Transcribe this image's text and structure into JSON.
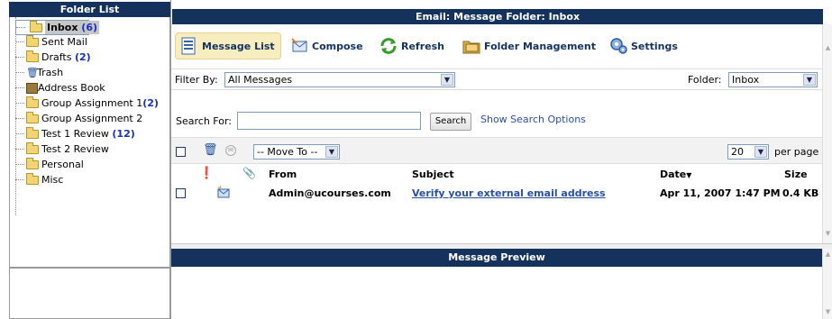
{
  "folder_panel": {
    "title": "Folder List",
    "folders": [
      {
        "name": "Inbox",
        "count": "(6)"
      },
      {
        "name": "Sent Mail",
        "count": ""
      },
      {
        "name": "Drafts",
        "count": "(2)"
      },
      {
        "name": "Trash",
        "count": ""
      },
      {
        "name": "Address Book",
        "count": ""
      },
      {
        "name": "Group Assignment 1",
        "count": "(2)"
      },
      {
        "name": "Group Assignment 2",
        "count": ""
      },
      {
        "name": "Test 1 Review",
        "count": "(12)"
      },
      {
        "name": "Test 2 Review",
        "count": ""
      },
      {
        "name": "Personal",
        "count": ""
      },
      {
        "name": "Misc",
        "count": ""
      }
    ]
  },
  "main": {
    "title": "Email: Message Folder: Inbox",
    "toolbar": {
      "message_list": "Message List",
      "compose": "Compose",
      "refresh": "Refresh",
      "folder_management": "Folder Management",
      "settings": "Settings"
    },
    "filter": {
      "label": "Filter By:",
      "value": "All Messages",
      "folder_label": "Folder:",
      "folder_value": "Inbox"
    },
    "search": {
      "label": "Search For:",
      "value": "",
      "button": "Search",
      "options_link": "Show Search Options"
    },
    "actions": {
      "move_to": "-- Move To --",
      "per_page_value": "20",
      "per_page_label": "per page"
    },
    "columns": {
      "from": "From",
      "subject": "Subject",
      "date": "Date",
      "date_sort": "▼",
      "size": "Size"
    },
    "messages": [
      {
        "from": "Admin@ucourses.com",
        "subject": "Verify your external email address",
        "date": "Apr 11, 2007 1:47 PM",
        "size": "0.4 KB"
      }
    ],
    "preview_title": "Message Preview"
  },
  "colors": {
    "header_bg": "#14325c",
    "link": "#2a4fa8",
    "unread_count": "#1a2fc0",
    "selected_toolbar": "#f7edbf"
  }
}
